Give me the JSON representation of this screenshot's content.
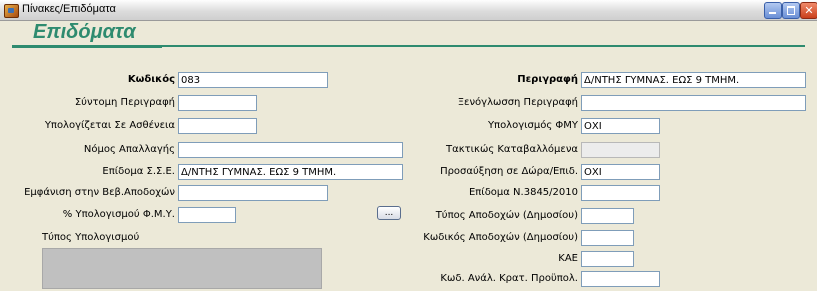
{
  "window": {
    "title": "Πίνακες/Επιδόματα",
    "icon": "app-icon",
    "controls": [
      "minimize-icon",
      "maximize-icon",
      "close-icon"
    ],
    "close_glyph": "✕"
  },
  "header": {
    "title": "Επιδόματα"
  },
  "form": {
    "left": {
      "code_label": "Κωδικός",
      "code_value": "083",
      "short_desc_label": "Σύντομη Περιγραφή",
      "short_desc_value": "",
      "sick_calc_label": "Υπολογίζεται Σε Ασθένεια",
      "sick_calc_value": "",
      "law_label": "Νόμος Απαλλαγής",
      "law_value": "",
      "sse_allowance_label": "Επίδομα Σ.Σ.Ε.",
      "sse_allowance_value": "Δ/ΝΤΗΣ ΓΥΜΝΑΣ. ΕΩΣ 9 ΤΜΗΜ.",
      "payslip_display_label": "Εμφάνιση στην Βεβ.Αποδοχών",
      "payslip_display_value": "",
      "fmy_percent_label": "% Υπολογισμού Φ.Μ.Υ.",
      "fmy_percent_value": "",
      "dots_button": "...",
      "calc_type_label": "Τύπος Υπολογισμού"
    },
    "right": {
      "description_label": "Περιγραφή",
      "description_value": "Δ/ΝΤΗΣ ΓΥΜΝΑΣ. ΕΩΣ 9 ΤΜΗΜ.",
      "foreign_desc_label": "Ξενόγλωσση Περιγραφή",
      "foreign_desc_value": "",
      "fmy_calc_label": "Υπολογισμός ΦΜΥ",
      "fmy_calc_value": "ΟΧΙ",
      "regular_paid_label": "Τακτικώς Καταβαλλόμενα",
      "regular_paid_value": "",
      "gift_increase_label": "Προσαύξηση σε Δώρα/Επιδ.",
      "gift_increase_value": "ΟΧΙ",
      "law_allowance_label": "Επίδομα Ν.3845/2010",
      "law_allowance_value": "",
      "public_pay_type_label": "Τύπος Αποδοχών (Δημοσίου)",
      "public_pay_type_value": "",
      "public_pay_code_label": "Κωδικός Αποδοχών (Δημοσίου)",
      "public_pay_code_value": "",
      "kae_label": "ΚΑΕ",
      "kae_value": "",
      "budget_code_label": "Κωδ. Ανάλ. Κρατ. Προϋπολ.",
      "budget_code_value": ""
    }
  },
  "colors": {
    "accent": "#2e8b6f",
    "background": "#ece9d8",
    "field_border": "#7f9db9",
    "disabled_field": "#ececec",
    "calc_type_box": "#c0c0c0"
  }
}
